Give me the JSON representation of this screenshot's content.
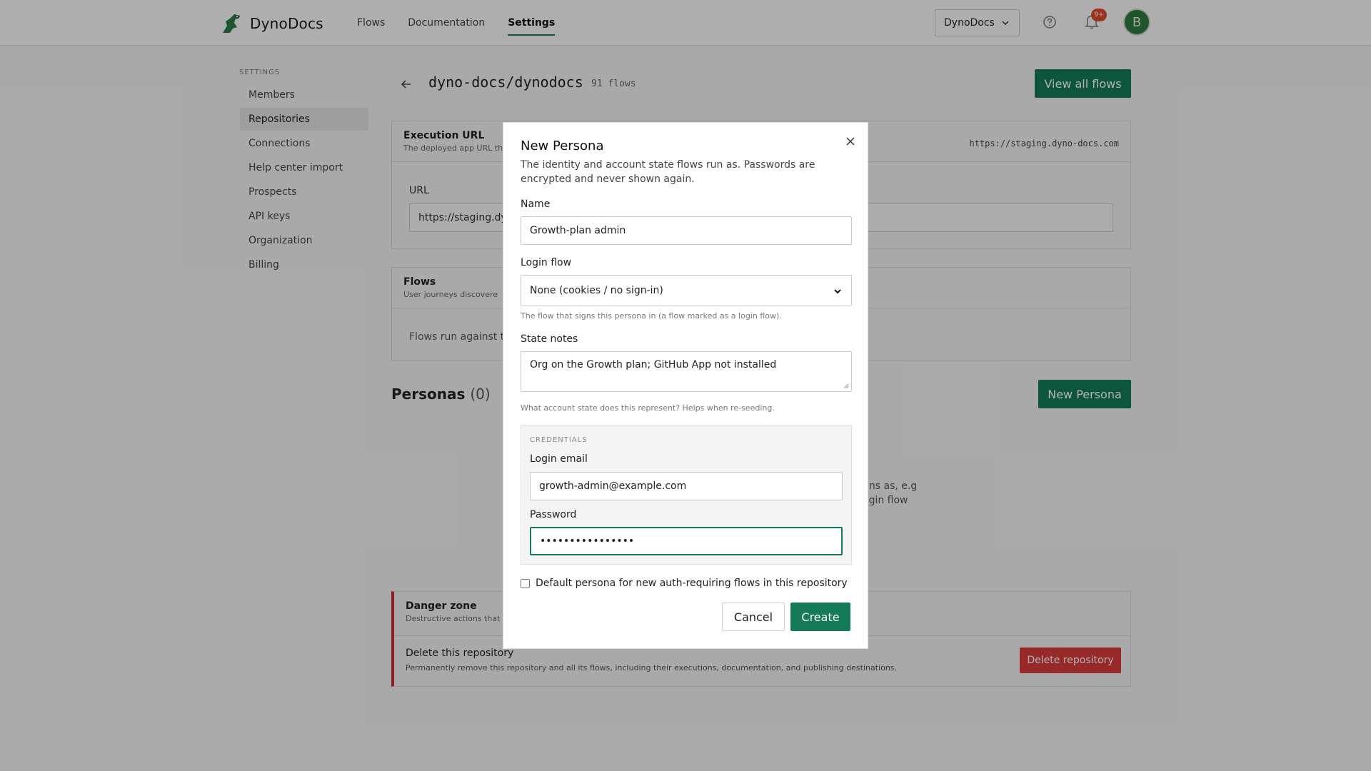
{
  "app": {
    "name": "DynoDocs"
  },
  "nav": {
    "flows": "Flows",
    "documentation": "Documentation",
    "settings": "Settings"
  },
  "header": {
    "org_select": "DynoDocs",
    "notification_badge": "9+",
    "avatar_initial": "B"
  },
  "sidebar": {
    "heading": "SETTINGS",
    "items": [
      {
        "label": "Members"
      },
      {
        "label": "Repositories"
      },
      {
        "label": "Connections"
      },
      {
        "label": "Help center import"
      },
      {
        "label": "Prospects"
      },
      {
        "label": "API keys"
      },
      {
        "label": "Organization"
      },
      {
        "label": "Billing"
      }
    ]
  },
  "repo": {
    "title": "dyno-docs/dynodocs",
    "flow_count": "91 flows",
    "view_all": "View all flows"
  },
  "execution": {
    "title": "Execution URL",
    "subtitle": "The deployed app URL th",
    "url_right": "https://staging.dyno-docs.com",
    "url_label": "URL",
    "url_value": "https://staging.dyn"
  },
  "flows_section": {
    "title": "Flows",
    "subtitle": "User journeys discovere",
    "body": "Flows run against th"
  },
  "personas": {
    "title": "Personas",
    "count": "(0)",
    "new_button": "New Persona",
    "empty_line1": "uns as, e.g",
    "empty_line2": "ogin flow"
  },
  "danger": {
    "title": "Danger zone",
    "subtitle": "Destructive actions that",
    "delete_title": "Delete this repository",
    "delete_desc": "Permanently remove this repository and all its flows, including their executions, documentation, and publishing destinations.",
    "delete_button": "Delete repository"
  },
  "modal": {
    "title": "New Persona",
    "description": "The identity and account state flows run as. Passwords are encrypted and never shown again.",
    "name_label": "Name",
    "name_value": "Growth-plan admin",
    "login_flow_label": "Login flow",
    "login_flow_value": "None (cookies / no sign-in)",
    "login_flow_help": "The flow that signs this persona in (a flow marked as a login flow).",
    "state_notes_label": "State notes",
    "state_notes_value": "Org on the Growth plan; GitHub App not installed",
    "state_notes_help": "What account state does this represent? Helps when re-seeding.",
    "credentials_heading": "CREDENTIALS",
    "email_label": "Login email",
    "email_value": "growth-admin@example.com",
    "password_label": "Password",
    "password_value": "••••••••••••••••",
    "default_checkbox": "Default persona for new auth-requiring flows in this repository",
    "cancel": "Cancel",
    "create": "Create"
  },
  "colors": {
    "accent": "#147a57",
    "danger": "#d93b3b",
    "badge": "#e04a2f"
  }
}
